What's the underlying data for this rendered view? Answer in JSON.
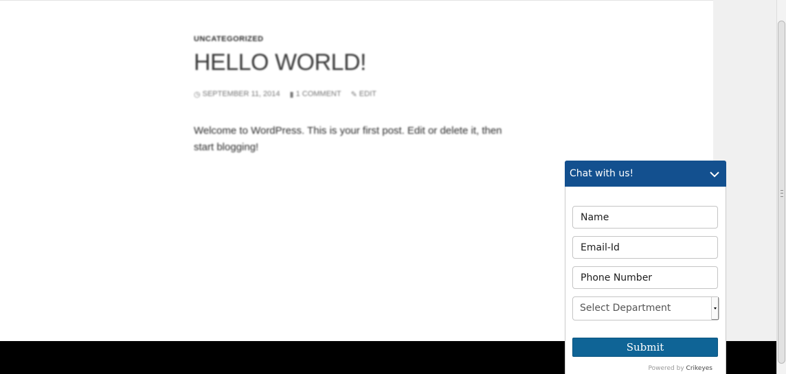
{
  "post": {
    "category": "UNCATEGORIZED",
    "title": "HELLO WORLD!",
    "date": "SEPTEMBER 11, 2014",
    "comments": "1 COMMENT",
    "edit": "EDIT",
    "body": "Welcome to WordPress. This is your first post. Edit or delete it, then start blogging!"
  },
  "chat": {
    "title": "Chat with us!",
    "name_placeholder": "Name",
    "email_placeholder": "Email-Id",
    "phone_placeholder": "Phone Number",
    "department_selected": "Select Department",
    "submit_label": "Submit",
    "powered_by_prefix": "Powered by",
    "powered_by_brand": "Crikeyes",
    "header_color": "#13508f",
    "submit_color": "#0f6496"
  },
  "icons": {
    "date": "clock-icon",
    "comments": "comment-icon",
    "edit": "pencil-icon",
    "toggle": "chevron-down-icon"
  }
}
